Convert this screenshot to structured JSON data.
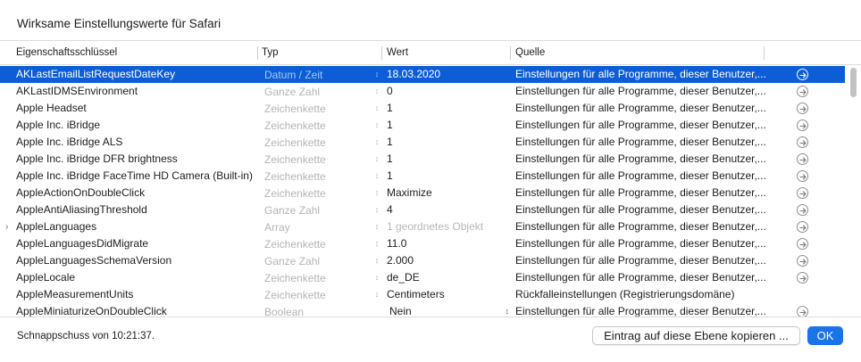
{
  "window": {
    "title": "Wirksame Einstellungswerte für Safari"
  },
  "table": {
    "columns": [
      "Eigenschaftsschlüssel",
      "Typ",
      "Wert",
      "Quelle"
    ],
    "rows": [
      {
        "key": "AKLastEmailListRequestDateKey",
        "type": "Datum / Zeit",
        "value": "18.03.2020",
        "source": "Einstellungen für alle Programme, dieser Benutzer,...",
        "selected": true
      },
      {
        "key": "AKLastIDMSEnvironment",
        "type": "Ganze Zahl",
        "value": "0",
        "source": "Einstellungen für alle Programme, dieser Benutzer,..."
      },
      {
        "key": "Apple Headset",
        "type": "Zeichenkette",
        "value": "1",
        "source": "Einstellungen für alle Programme, dieser Benutzer,..."
      },
      {
        "key": "Apple Inc. iBridge",
        "type": "Zeichenkette",
        "value": "1",
        "source": "Einstellungen für alle Programme, dieser Benutzer,..."
      },
      {
        "key": "Apple Inc. iBridge ALS",
        "type": "Zeichenkette",
        "value": "1",
        "source": "Einstellungen für alle Programme, dieser Benutzer,..."
      },
      {
        "key": "Apple Inc. iBridge DFR brightness",
        "type": "Zeichenkette",
        "value": "1",
        "source": "Einstellungen für alle Programme, dieser Benutzer,..."
      },
      {
        "key": "Apple Inc. iBridge FaceTime HD Camera (Built-in)",
        "type": "Zeichenkette",
        "value": "1",
        "source": "Einstellungen für alle Programme, dieser Benutzer,..."
      },
      {
        "key": "AppleActionOnDoubleClick",
        "type": "Zeichenkette",
        "value": "Maximize",
        "source": "Einstellungen für alle Programme, dieser Benutzer,..."
      },
      {
        "key": "AppleAntiAliasingThreshold",
        "type": "Ganze Zahl",
        "value": "4",
        "source": "Einstellungen für alle Programme, dieser Benutzer,..."
      },
      {
        "key": "AppleLanguages",
        "type": "Array",
        "value": "1 geordnetes Objekt",
        "source": "Einstellungen für alle Programme, dieser Benutzer,...",
        "expandable": true,
        "dim_value": true
      },
      {
        "key": "AppleLanguagesDidMigrate",
        "type": "Zeichenkette",
        "value": "11.0",
        "source": "Einstellungen für alle Programme, dieser Benutzer,..."
      },
      {
        "key": "AppleLanguagesSchemaVersion",
        "type": "Ganze Zahl",
        "value": "2.000",
        "source": "Einstellungen für alle Programme, dieser Benutzer,..."
      },
      {
        "key": "AppleLocale",
        "type": "Zeichenkette",
        "value": "de_DE",
        "source": "Einstellungen für alle Programme, dieser Benutzer,..."
      },
      {
        "key": "AppleMeasurementUnits",
        "type": "Zeichenkette",
        "value": "Centimeters",
        "source": "Rückfalleinstellungen (Registrierungsdomäne)",
        "no_action": true
      },
      {
        "key": "AppleMiniaturizeOnDoubleClick",
        "type": "Boolean",
        "value": "Nein",
        "source": "Einstellungen für alle Programme, dieser Benutzer,...",
        "popup": true
      }
    ]
  },
  "footer": {
    "status": "Schnappschuss von 10:21:37.",
    "copy_button": "Eintrag auf diese Ebene kopieren ...",
    "ok_button": "OK"
  },
  "icons": {
    "stepper": "stepper-icon",
    "action": "arrow-right-circle-icon",
    "disclosure": "disclosure-triangle-icon",
    "popup": "popup-chevron-icon"
  },
  "colors": {
    "selection": "#0d5ed6",
    "accent": "#1a73e8"
  }
}
